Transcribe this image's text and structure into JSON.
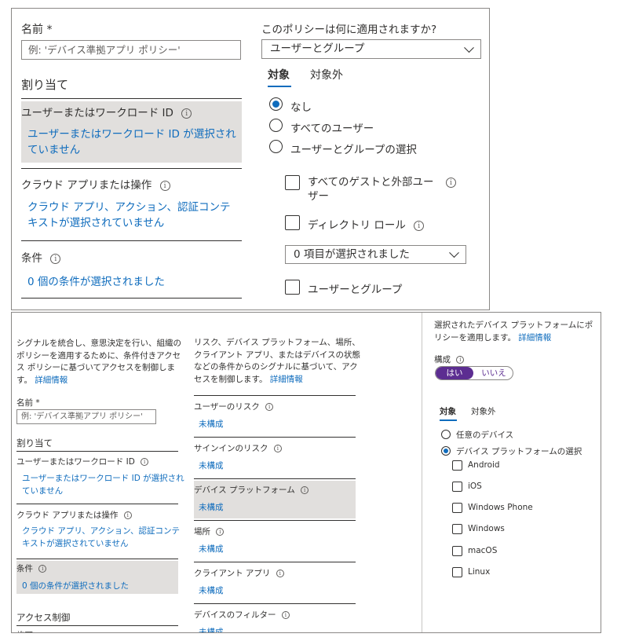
{
  "top": {
    "name_label": "名前 *",
    "name_placeholder": "例: 'デバイス準拠アプリ ポリシー'",
    "assignments_heading": "割り当て",
    "users_heading": "ユーザーまたはワークロード ID",
    "users_value_line1": "ユーザーまたはワークロード ID が選択され",
    "users_value_line2": "ていません",
    "cloud_heading": "クラウド アプリまたは操作",
    "cloud_value_line1": "クラウド アプリ、アクション、認証コンテ",
    "cloud_value_line2": "キストが選択されていません",
    "conditions_heading": "条件",
    "conditions_value": "0 個の条件が選択されました",
    "apply_question": "このポリシーは何に適用されますか?",
    "apply_dropdown_value": "ユーザーとグループ",
    "tabs": [
      "対象",
      "対象外"
    ],
    "radios": [
      "なし",
      "すべてのユーザー",
      "ユーザーとグループの選択"
    ],
    "guest_line1": "すべてのゲストと外部ユー",
    "guest_line2": "ザー",
    "directory_roles": "ディレクトリ ロール",
    "items_selected": "0 項目が選択されました",
    "users_groups": "ユーザーとグループ"
  },
  "bottom": {
    "intro_line1": "シグナルを統合し、意思決定を行い、組織の",
    "intro_line2": "ポリシーを適用するために、条件付きアクセ",
    "intro_line3": "ス ポリシーに基づいてアクセスを制御しま",
    "intro_line4": "す。",
    "learn_more": "詳細情報",
    "name_label": "名前 *",
    "name_placeholder": "例: 'デバイス準拠アプリ ポリシー'",
    "assignments_heading": "割り当て",
    "users_heading": "ユーザーまたはワークロード ID",
    "users_value_line1": "ユーザーまたはワークロード ID が選択され",
    "users_value_line2": "ていません",
    "cloud_heading": "クラウド アプリまたは操作",
    "cloud_value_line1": "クラウド アプリ、アクション、認証コンテ",
    "cloud_value_line2": "キストが選択されていません",
    "conditions_heading": "条件",
    "conditions_value": "0 個の条件が選択されました",
    "access_heading": "アクセス制御",
    "grant_label": "許可",
    "mid_intro_line1": "リスク、デバイス プラットフォーム、場所、",
    "mid_intro_line2": "クライアント アプリ、またはデバイスの状態",
    "mid_intro_line3": "などの条件からのシグナルに基づいて、アク",
    "mid_intro_line4": "セスを制御します。",
    "conditions": [
      {
        "label": "ユーザーのリスク",
        "value": "未構成"
      },
      {
        "label": "サインインのリスク",
        "value": "未構成"
      },
      {
        "label": "デバイス プラットフォーム",
        "value": "未構成"
      },
      {
        "label": "場所",
        "value": "未構成"
      },
      {
        "label": "クライアント アプリ",
        "value": "未構成"
      },
      {
        "label": "デバイスのフィルター",
        "value": "未構成"
      }
    ],
    "right_intro_line1": "選択されたデバイス プラットフォームにポ",
    "right_intro_line2": "リシーを適用します。",
    "configure_label": "構成",
    "toggle_yes": "はい",
    "toggle_no": "いいえ",
    "tabs": [
      "対象",
      "対象外"
    ],
    "radios": [
      "任意のデバイス",
      "デバイス プラットフォームの選択"
    ],
    "platforms": [
      "Android",
      "iOS",
      "Windows Phone",
      "Windows",
      "macOS",
      "Linux"
    ],
    "selected_radio": "デバイス プラットフォームの選択",
    "toggle_selected": "はい"
  },
  "colors": {
    "accent": "#0f6cbd",
    "toggle_purple": "#5c2d91",
    "selected_bg": "#e1dfdd"
  }
}
